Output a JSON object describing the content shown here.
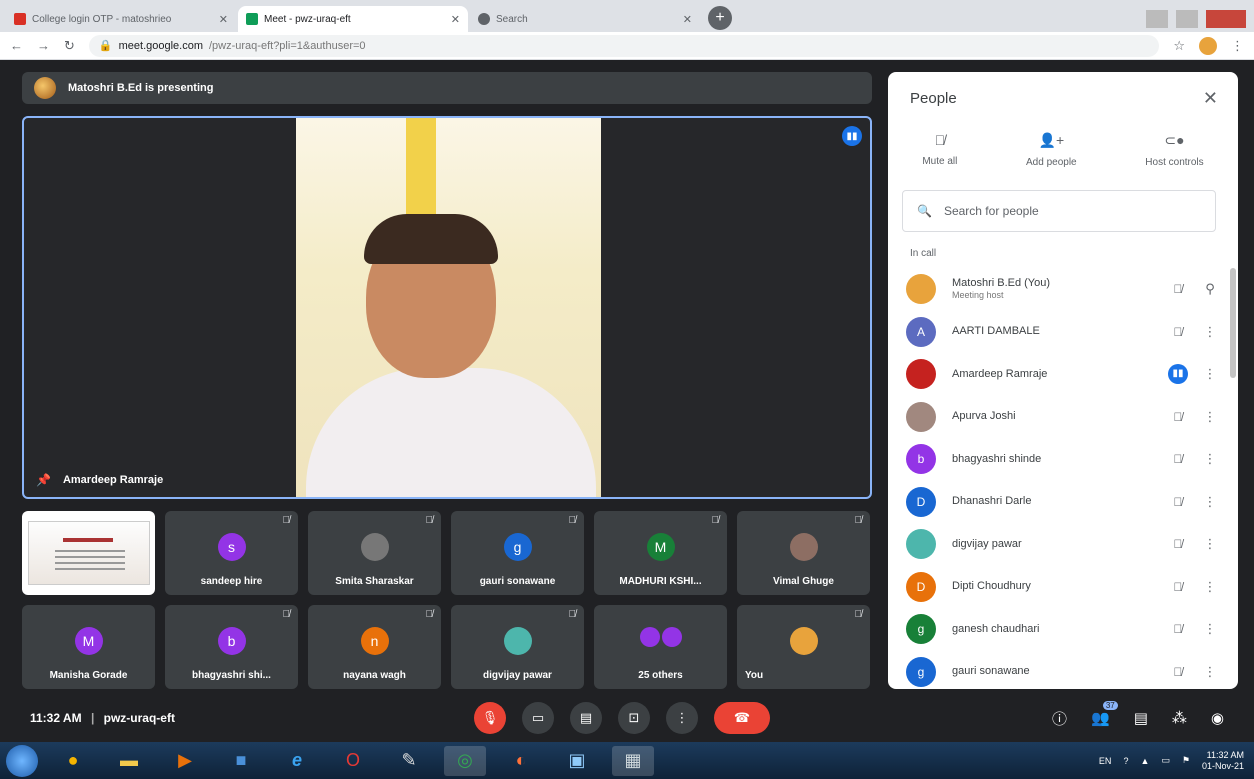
{
  "browser": {
    "tabs": [
      {
        "title": "College login OTP - matoshrieo",
        "favicon_color": "#d93025",
        "active": false
      },
      {
        "title": "Meet - pwz-uraq-eft",
        "favicon_color": "#0f9d58",
        "active": true
      },
      {
        "title": "Search",
        "favicon_color": "#5f6368",
        "active": false
      }
    ],
    "new_tab": "+",
    "url_host": "meet.google.com",
    "url_rest": "/pwz-uraq-eft?pli=1&authuser=0"
  },
  "banner": {
    "text": "Matoshri B.Ed is presenting"
  },
  "main_tile": {
    "name": "Amardeep Ramraje"
  },
  "tiles": [
    {
      "name": "",
      "type": "slide"
    },
    {
      "name": "sandeep hire",
      "initial": "s",
      "color": "#9334e6"
    },
    {
      "name": "Smita Sharaskar",
      "initial": "",
      "color": "#3c4043"
    },
    {
      "name": "gauri sonawane",
      "initial": "g",
      "color": "#1967d2"
    },
    {
      "name": "MADHURI KSHI...",
      "initial": "M",
      "color": "#188038"
    },
    {
      "name": "Vimal Ghuge",
      "initial": "",
      "color": "#8d6e63"
    },
    {
      "name": "Manisha Gorade",
      "initial": "M",
      "color": "#9334e6"
    },
    {
      "name": "bhagyashri shi...",
      "initial": "b",
      "color": "#9334e6"
    },
    {
      "name": "nayana wagh",
      "initial": "n",
      "color": "#e8710a"
    },
    {
      "name": "digvijay pawar",
      "initial": "",
      "color": "#4db6ac"
    },
    {
      "name": "25 others",
      "initial": "",
      "color": "#9334e6"
    },
    {
      "name": "You",
      "initial": "",
      "color": "#e8a33c"
    }
  ],
  "bottom": {
    "time": "11:32 AM",
    "separator": "|",
    "meeting_code": "pwz-uraq-eft",
    "participants_count": "37"
  },
  "people_panel": {
    "title": "People",
    "actions": [
      {
        "label": "Mute all",
        "icon": "mic-off-icon"
      },
      {
        "label": "Add people",
        "icon": "add-person-icon"
      },
      {
        "label": "Host controls",
        "icon": "toggle-icon"
      }
    ],
    "search_placeholder": "Search for people",
    "section_label": "In call",
    "participants": [
      {
        "name": "Matoshri B.Ed (You)",
        "sub": "Meeting host",
        "initial": "",
        "color": "#e8a33c",
        "speaking": false,
        "pin": true
      },
      {
        "name": "AARTI DAMBALE",
        "sub": "",
        "initial": "A",
        "color": "#5c6bc0",
        "speaking": false,
        "pin": false
      },
      {
        "name": "Amardeep Ramraje",
        "sub": "",
        "initial": "",
        "color": "#c5221f",
        "speaking": true,
        "pin": false
      },
      {
        "name": "Apurva Joshi",
        "sub": "",
        "initial": "",
        "color": "#a1887f",
        "speaking": false,
        "pin": false
      },
      {
        "name": "bhagyashri shinde",
        "sub": "",
        "initial": "b",
        "color": "#9334e6",
        "speaking": false,
        "pin": false
      },
      {
        "name": "Dhanashri Darle",
        "sub": "",
        "initial": "D",
        "color": "#1967d2",
        "speaking": false,
        "pin": false
      },
      {
        "name": "digvijay pawar",
        "sub": "",
        "initial": "",
        "color": "#4db6ac",
        "speaking": false,
        "pin": false
      },
      {
        "name": "Dipti Choudhury",
        "sub": "",
        "initial": "D",
        "color": "#e8710a",
        "speaking": false,
        "pin": false
      },
      {
        "name": "ganesh chaudhari",
        "sub": "",
        "initial": "g",
        "color": "#188038",
        "speaking": false,
        "pin": false
      },
      {
        "name": "gauri sonawane",
        "sub": "",
        "initial": "g",
        "color": "#1967d2",
        "speaking": false,
        "pin": false
      }
    ]
  },
  "taskbar": {
    "lang": "EN",
    "time": "11:32 AM",
    "date": "01-Nov-21"
  }
}
